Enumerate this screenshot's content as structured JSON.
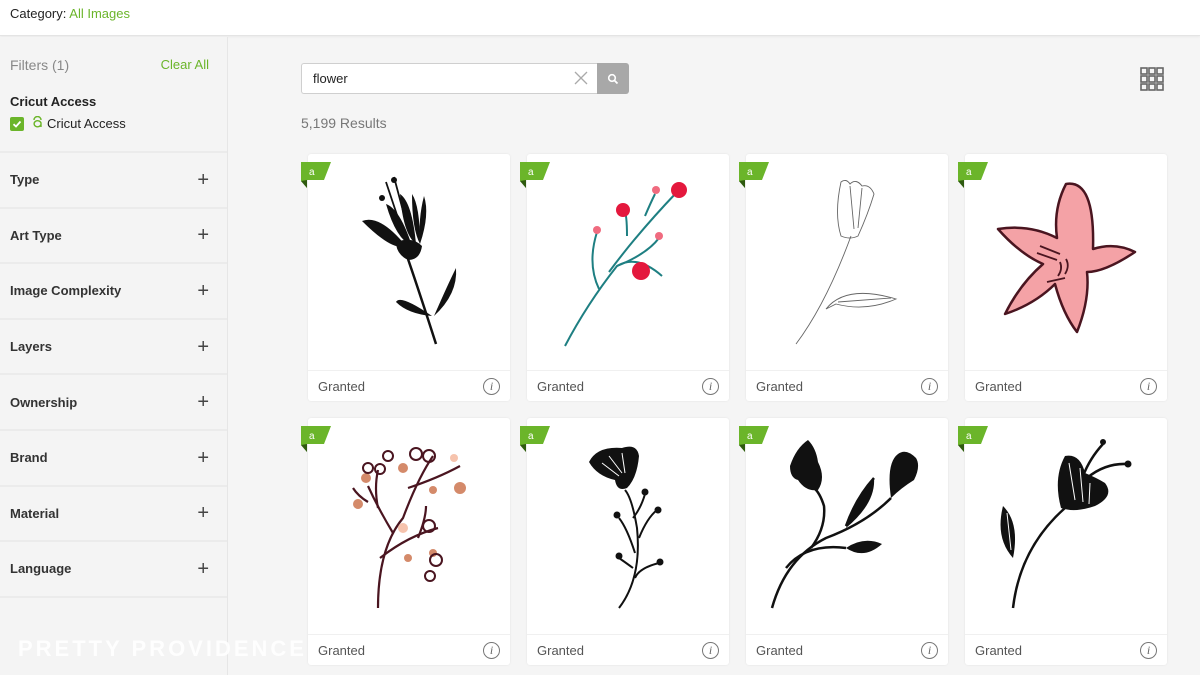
{
  "header": {
    "category_label": "Category:",
    "category_value": "All Images"
  },
  "sidebar": {
    "filters_title": "Filters (1)",
    "clear_all_label": "Clear All",
    "access_section_title": "Cricut Access",
    "access_checkbox_label": "Cricut Access",
    "access_checked": true,
    "filters": [
      {
        "label": "Type",
        "icon": "plus-icon"
      },
      {
        "label": "Art Type",
        "icon": "plus-icon"
      },
      {
        "label": "Image Complexity",
        "icon": "plus-icon"
      },
      {
        "label": "Layers",
        "icon": "plus-icon"
      },
      {
        "label": "Ownership",
        "icon": "plus-icon"
      },
      {
        "label": "Brand",
        "icon": "plus-icon"
      },
      {
        "label": "Material",
        "icon": "plus-icon"
      },
      {
        "label": "Language",
        "icon": "plus-icon"
      }
    ],
    "plus_glyph": "+"
  },
  "search": {
    "value": "flower",
    "results_text": "5,199 Results"
  },
  "colors": {
    "accent_green": "#6bb52a",
    "search_button": "#a8a8a8"
  },
  "watermark": "PRETTY PROVIDENCE",
  "cards": [
    {
      "status": "Granted",
      "art": "black-flower-with-stamens",
      "info": "i"
    },
    {
      "status": "Granted",
      "art": "teal-branch-red-berries",
      "info": "i"
    },
    {
      "status": "Granted",
      "art": "outline-flower-with-leaf",
      "info": "i"
    },
    {
      "status": "Granted",
      "art": "pink-five-petal-flower",
      "info": "i"
    },
    {
      "status": "Granted",
      "art": "brown-berry-branch",
      "info": "i"
    },
    {
      "status": "Granted",
      "art": "black-flower-sprig",
      "info": "i"
    },
    {
      "status": "Granted",
      "art": "black-two-tulip-branch",
      "info": "i"
    },
    {
      "status": "Granted",
      "art": "black-tulip-with-leaf",
      "info": "i"
    }
  ]
}
